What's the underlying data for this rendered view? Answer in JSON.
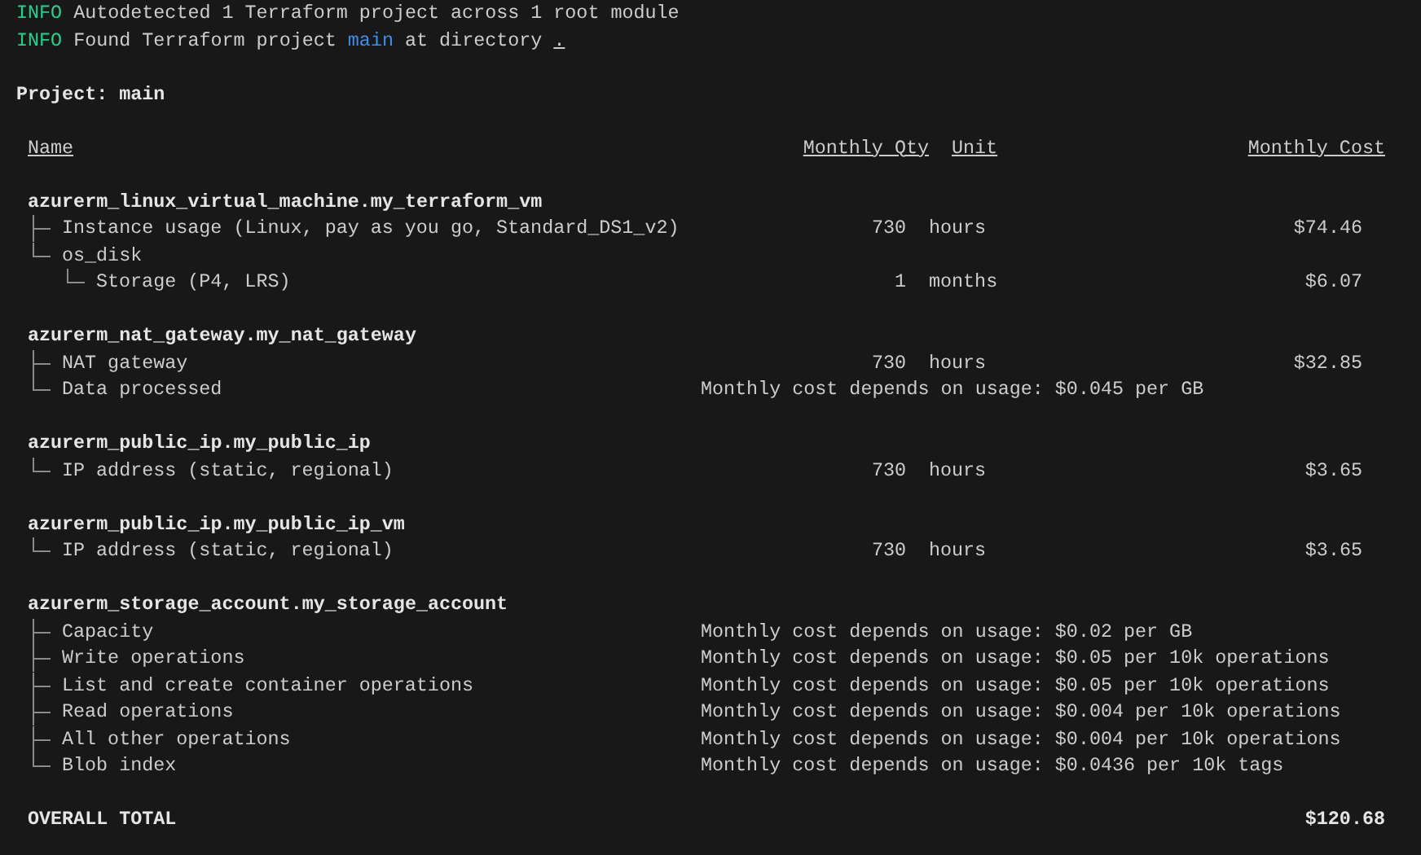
{
  "log": [
    {
      "level": "INFO",
      "message": "Autodetected 1 Terraform project across 1 root module"
    },
    {
      "level": "INFO",
      "message": "Found Terraform project",
      "project": "main",
      "after": "at directory",
      "path": "."
    }
  ],
  "project_line": "Project: main",
  "columns": [
    "Name",
    "Monthly Qty",
    "Unit",
    "Monthly Cost"
  ],
  "resources": [
    {
      "name": "azurerm_linux_virtual_machine.my_terraform_vm",
      "components": [
        {
          "kind": "priced",
          "name": "Instance usage (Linux, pay as you go, Standard_DS1_v2)",
          "qty": "730",
          "unit": "hours",
          "cost": "$74.46"
        },
        {
          "kind": "group",
          "name": "os_disk",
          "children": [
            {
              "kind": "priced",
              "name": "Storage (P4, LRS)",
              "qty": "1",
              "unit": "months",
              "cost": "$6.07"
            }
          ]
        }
      ]
    },
    {
      "name": "azurerm_nat_gateway.my_nat_gateway",
      "components": [
        {
          "kind": "priced",
          "name": "NAT gateway",
          "qty": "730",
          "unit": "hours",
          "cost": "$32.85"
        },
        {
          "kind": "usage",
          "name": "Data processed",
          "note": "Monthly cost depends on usage: $0.045 per GB"
        }
      ]
    },
    {
      "name": "azurerm_public_ip.my_public_ip",
      "components": [
        {
          "kind": "priced",
          "name": "IP address (static, regional)",
          "qty": "730",
          "unit": "hours",
          "cost": "$3.65"
        }
      ]
    },
    {
      "name": "azurerm_public_ip.my_public_ip_vm",
      "components": [
        {
          "kind": "priced",
          "name": "IP address (static, regional)",
          "qty": "730",
          "unit": "hours",
          "cost": "$3.65"
        }
      ]
    },
    {
      "name": "azurerm_storage_account.my_storage_account",
      "components": [
        {
          "kind": "usage",
          "name": "Capacity",
          "note": "Monthly cost depends on usage: $0.02 per GB"
        },
        {
          "kind": "usage",
          "name": "Write operations",
          "note": "Monthly cost depends on usage: $0.05 per 10k operations"
        },
        {
          "kind": "usage",
          "name": "List and create container operations",
          "note": "Monthly cost depends on usage: $0.05 per 10k operations"
        },
        {
          "kind": "usage",
          "name": "Read operations",
          "note": "Monthly cost depends on usage: $0.004 per 10k operations"
        },
        {
          "kind": "usage",
          "name": "All other operations",
          "note": "Monthly cost depends on usage: $0.004 per 10k operations"
        },
        {
          "kind": "usage",
          "name": "Blob index",
          "note": "Monthly cost depends on usage: $0.0436 per 10k tags"
        }
      ]
    }
  ],
  "total": {
    "label": "OVERALL TOTAL",
    "cost": "$120.68"
  }
}
